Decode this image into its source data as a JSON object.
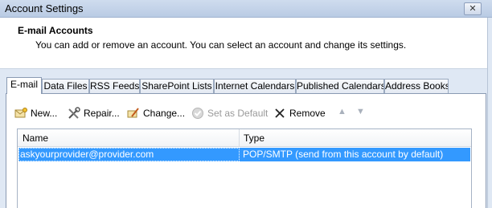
{
  "window": {
    "title": "Account Settings",
    "close_symbol": "✕"
  },
  "header": {
    "title": "E-mail Accounts",
    "description": "You can add or remove an account. You can select an account and change its settings."
  },
  "tabs": [
    {
      "label": "E-mail",
      "active": true
    },
    {
      "label": "Data Files",
      "active": false
    },
    {
      "label": "RSS Feeds",
      "active": false
    },
    {
      "label": "SharePoint Lists",
      "active": false
    },
    {
      "label": "Internet Calendars",
      "active": false
    },
    {
      "label": "Published Calendars",
      "active": false
    },
    {
      "label": "Address Books",
      "active": false
    }
  ],
  "toolbar": {
    "new_label": "New...",
    "repair_label": "Repair...",
    "change_label": "Change...",
    "set_default_label": "Set as Default",
    "remove_label": "Remove",
    "move_up_symbol": "▲",
    "move_down_symbol": "▼"
  },
  "accounts_table": {
    "columns": [
      "Name",
      "Type"
    ],
    "rows": [
      {
        "name": "askyourprovider@provider.com",
        "type": "POP/SMTP (send from this account by default)",
        "selected": true
      }
    ]
  },
  "icons": {
    "new": "new-account-icon",
    "repair": "repair-tools-icon",
    "change": "change-account-icon",
    "set_default": "checkmark-circle-icon",
    "remove": "x-remove-icon"
  },
  "colors": {
    "selection": "#3399ff",
    "header_bg": "#ffffff",
    "window_bg": "#dfe8f4"
  }
}
